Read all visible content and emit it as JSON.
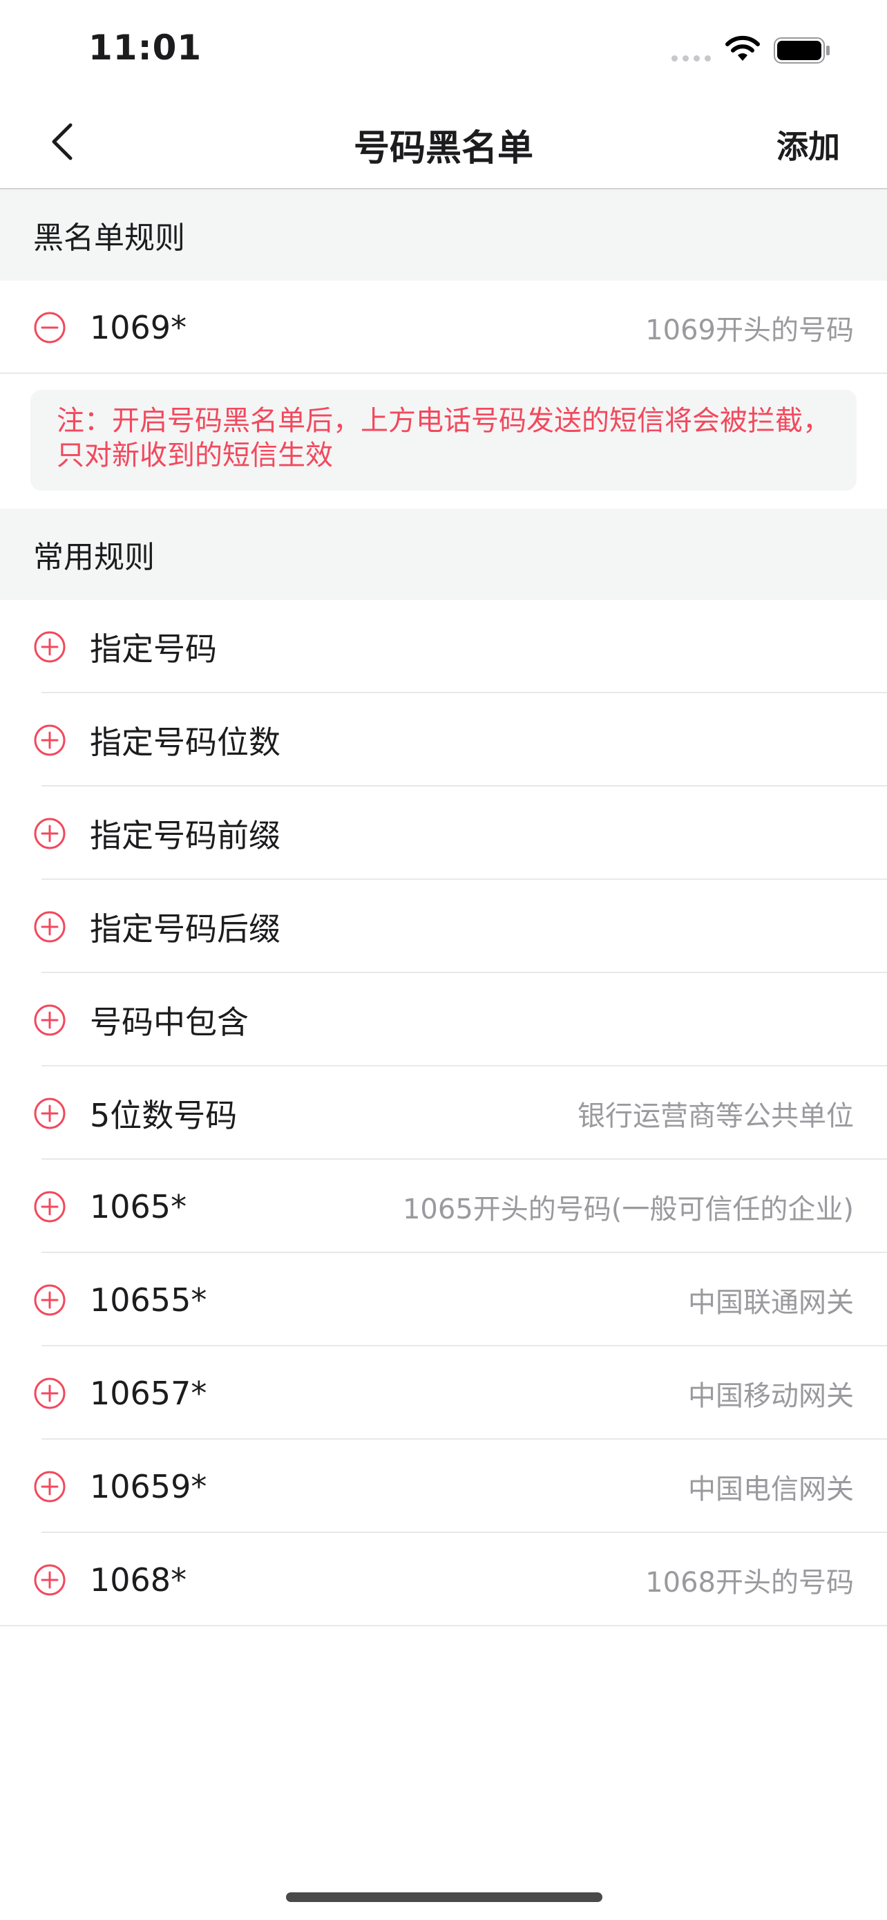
{
  "status_bar": {
    "time": "11:01"
  },
  "nav": {
    "title": "号码黑名单",
    "action": "添加"
  },
  "blacklist_section": {
    "header": "黑名单规则",
    "rules": [
      {
        "title": "1069*",
        "desc": "1069开头的号码"
      }
    ],
    "note": "注：开启号码黑名单后，上方电话号码发送的短信将会被拦截，只对新收到的短信生效"
  },
  "common_section": {
    "header": "常用规则",
    "rules": [
      {
        "title": "指定号码",
        "desc": ""
      },
      {
        "title": "指定号码位数",
        "desc": ""
      },
      {
        "title": "指定号码前缀",
        "desc": ""
      },
      {
        "title": "指定号码后缀",
        "desc": ""
      },
      {
        "title": "号码中包含",
        "desc": ""
      },
      {
        "title": "5位数号码",
        "desc": "银行运营商等公共单位"
      },
      {
        "title": "1065*",
        "desc": "1065开头的号码(一般可信任的企业)"
      },
      {
        "title": "10655*",
        "desc": "中国联通网关"
      },
      {
        "title": "10657*",
        "desc": "中国移动网关"
      },
      {
        "title": "10659*",
        "desc": "中国电信网关"
      },
      {
        "title": "1068*",
        "desc": "1068开头的号码"
      }
    ]
  },
  "colors": {
    "accent": "#f2495d",
    "section_bg": "#f4f5f5",
    "secondary_text": "#9a9a9e"
  },
  "icons": {
    "remove": "minus-circle-icon",
    "add": "plus-circle-icon",
    "back": "chevron-left-icon"
  }
}
